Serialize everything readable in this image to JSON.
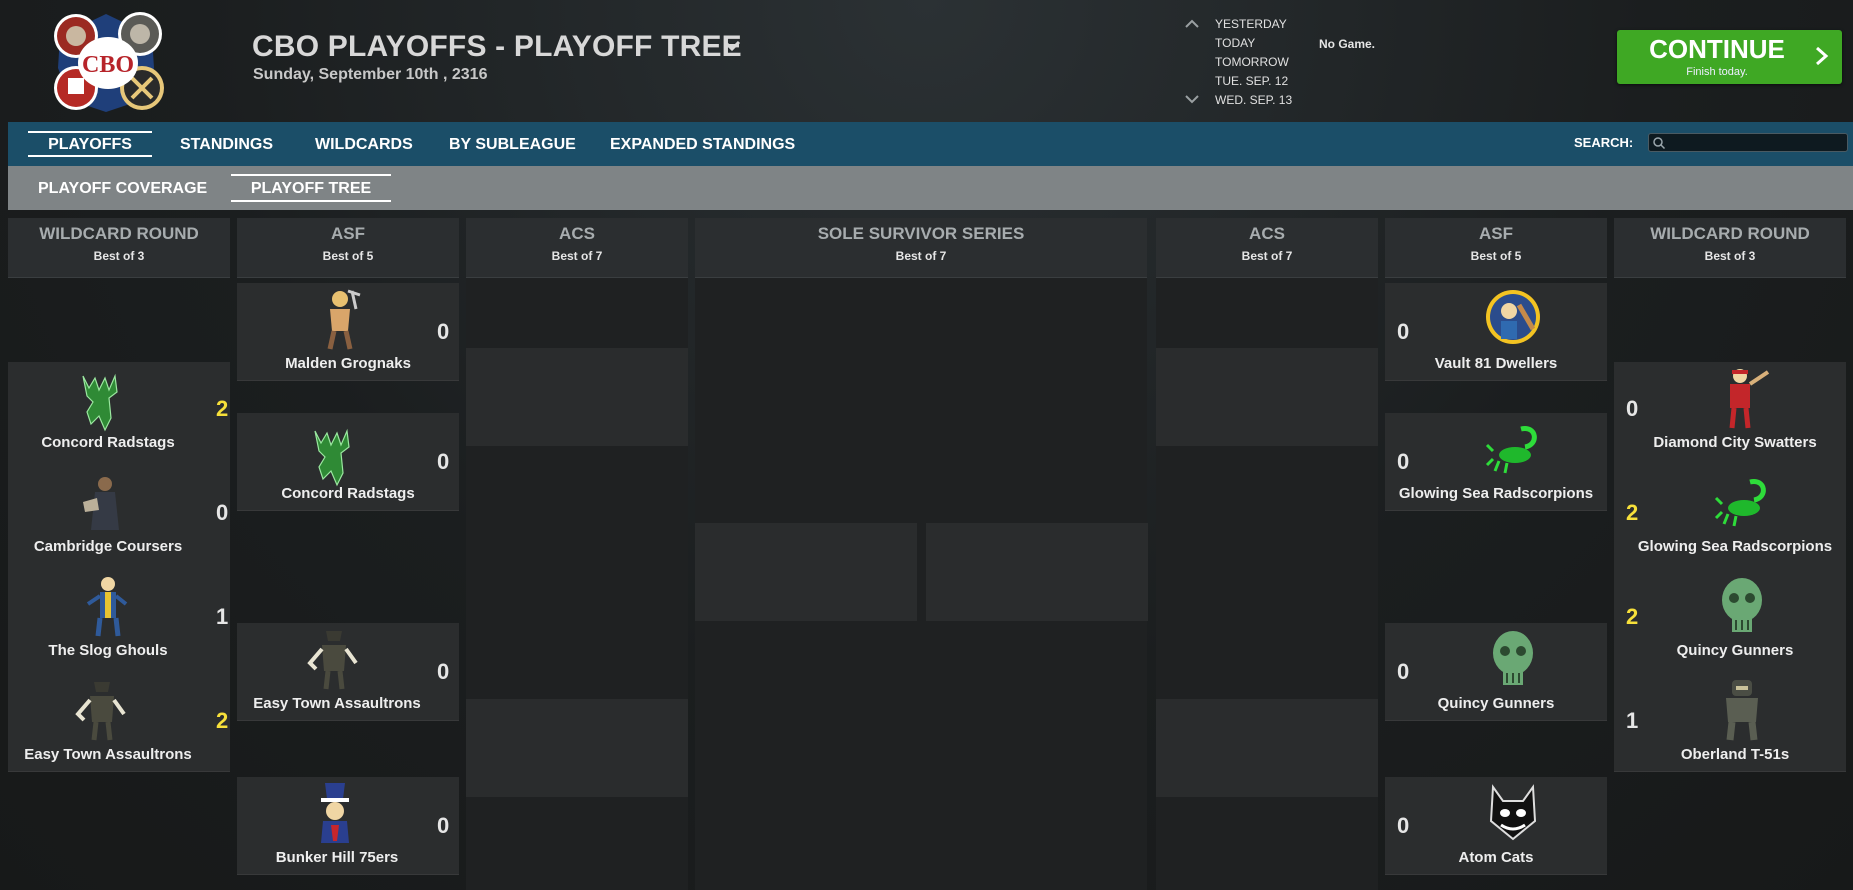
{
  "header": {
    "title": "CBO PLAYOFFS - PLAYOFF TREE",
    "date": "Sunday, September 10th , 2316",
    "logo_text": "CBO",
    "days": [
      "YESTERDAY",
      "TODAY",
      "TOMORROW",
      "TUE. SEP. 12",
      "WED. SEP. 13"
    ],
    "game_status": "No Game.",
    "continue_label": "CONTINUE",
    "continue_sub": "Finish today."
  },
  "nav": {
    "primary": [
      "PLAYOFFS",
      "STANDINGS",
      "WILDCARDS",
      "BY SUBLEAGUE",
      "EXPANDED STANDINGS"
    ],
    "active_primary": "PLAYOFFS",
    "search_label": "SEARCH:",
    "search_value": "",
    "secondary": [
      "PLAYOFF COVERAGE",
      "PLAYOFF TREE"
    ],
    "active_secondary": "PLAYOFF TREE"
  },
  "bracket": {
    "columns": [
      {
        "name": "WILDCARD ROUND",
        "best_of": "Best of 3"
      },
      {
        "name": "ASF",
        "best_of": "Best of 5"
      },
      {
        "name": "ACS",
        "best_of": "Best of 7"
      },
      {
        "name": "SOLE SURVIVOR SERIES",
        "best_of": "Best of 7"
      },
      {
        "name": "ACS",
        "best_of": "Best of 7"
      },
      {
        "name": "ASF",
        "best_of": "Best of 5"
      },
      {
        "name": "WILDCARD ROUND",
        "best_of": "Best of 3"
      }
    ],
    "left_wildcard": [
      {
        "team": "Concord Radstags",
        "score": "2",
        "winner": true,
        "icon": "moose-icon"
      },
      {
        "team": "Cambridge Coursers",
        "score": "0",
        "winner": false,
        "icon": "courser-icon"
      },
      {
        "team": "The Slog Ghouls",
        "score": "1",
        "winner": false,
        "icon": "vault-boy-icon"
      },
      {
        "team": "Easy Town Assaultrons",
        "score": "2",
        "winner": true,
        "icon": "assaultron-icon"
      }
    ],
    "left_asf": [
      {
        "team": "Malden Grognaks",
        "score": "0",
        "winner": false,
        "icon": "barbarian-icon"
      },
      {
        "team": "Concord Radstags",
        "score": "0",
        "winner": false,
        "icon": "moose-icon"
      },
      {
        "team": "Easy Town Assaultrons",
        "score": "0",
        "winner": false,
        "icon": "assaultron-icon"
      },
      {
        "team": "Bunker Hill 75ers",
        "score": "0",
        "winner": false,
        "icon": "uncle-sam-icon"
      }
    ],
    "right_asf": [
      {
        "team": "Vault 81 Dwellers",
        "score": "0",
        "winner": false,
        "icon": "vault-boy-bat-icon"
      },
      {
        "team": "Glowing Sea Radscorpions",
        "score": "0",
        "winner": false,
        "icon": "scorpion-icon"
      },
      {
        "team": "Quincy Gunners",
        "score": "0",
        "winner": false,
        "icon": "skull-icon"
      },
      {
        "team": "Atom Cats",
        "score": "0",
        "winner": false,
        "icon": "cat-icon"
      }
    ],
    "right_wildcard": [
      {
        "team": "Diamond City Swatters",
        "score": "0",
        "winner": false,
        "icon": "batter-icon"
      },
      {
        "team": "Glowing Sea Radscorpions",
        "score": "2",
        "winner": true,
        "icon": "scorpion-icon"
      },
      {
        "team": "Quincy Gunners",
        "score": "2",
        "winner": true,
        "icon": "skull-icon"
      },
      {
        "team": "Oberland T-51s",
        "score": "1",
        "winner": false,
        "icon": "power-armor-icon"
      }
    ]
  },
  "colors": {
    "accent_green": "#3fa824",
    "nav_primary": "#1b4e68",
    "nav_secondary": "#7f8486",
    "winner_score": "#f7e03a"
  }
}
